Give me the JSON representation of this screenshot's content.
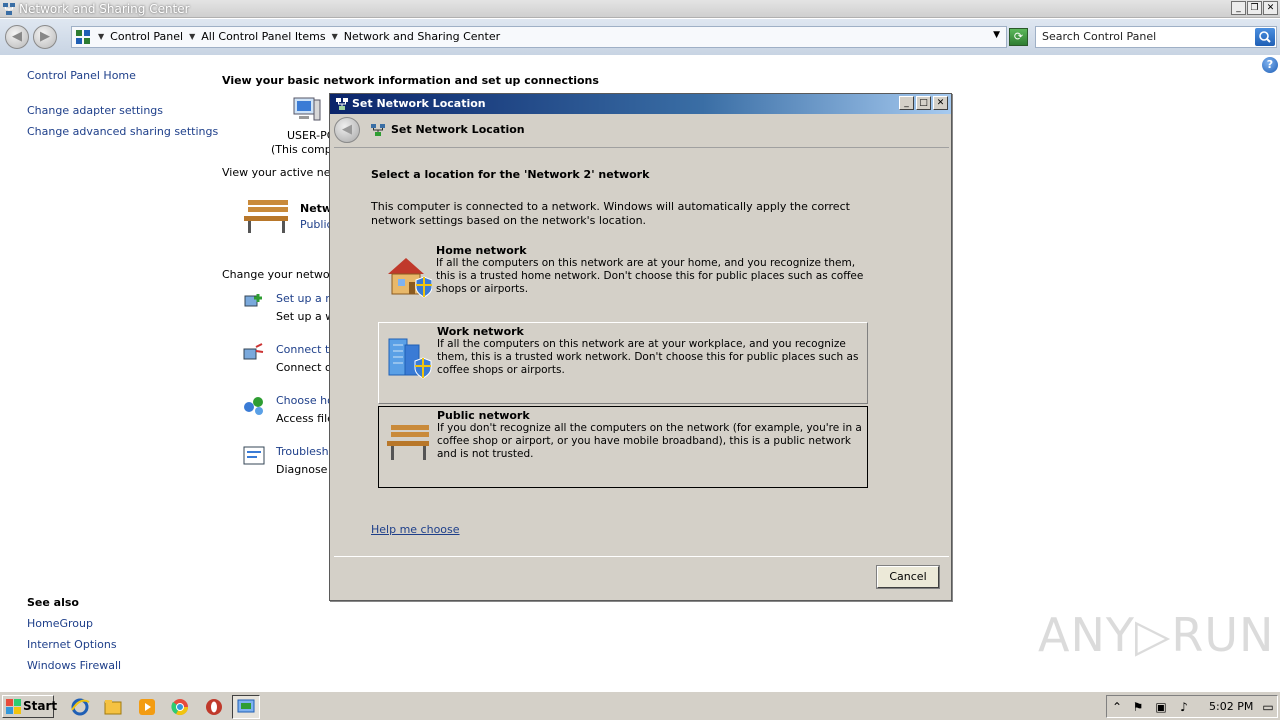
{
  "window": {
    "title": "Network and Sharing Center",
    "controls": {
      "minimize": "_",
      "maximize": "❐",
      "close": "✕"
    }
  },
  "address": {
    "crumbs": [
      "Control Panel",
      "All Control Panel Items",
      "Network and Sharing Center"
    ],
    "search_placeholder": "Search Control Panel"
  },
  "left_pane": {
    "home": "Control Panel Home",
    "links": [
      "Change adapter settings",
      "Change advanced sharing settings"
    ],
    "see_also_title": "See also",
    "see_also": [
      "HomeGroup",
      "Internet Options",
      "Windows Firewall"
    ]
  },
  "main": {
    "title": "View your basic network information and set up connections",
    "computer_name": "USER-PC",
    "computer_sub": "(This compu",
    "active_networks": "View your active netw",
    "network_name": "Netw",
    "network_type": "Public",
    "change_settings": "Change your networki",
    "tasks": [
      {
        "link": "Set up a ne",
        "desc": "Set up a wi"
      },
      {
        "link": "Connect to",
        "desc": "Connect or"
      },
      {
        "link": "Choose hor",
        "desc": "Access files"
      },
      {
        "link": "Troublesho",
        "desc": "Diagnose a"
      }
    ]
  },
  "dialog": {
    "title": "Set Network Location",
    "header_title": "Set Network Location",
    "heading": "Select a location for the 'Network  2' network",
    "intro": "This computer is connected to a network. Windows will automatically apply the correct network settings based on the network's location.",
    "options": [
      {
        "title": "Home network",
        "desc": "If all the computers on this network are at your home, and you recognize them, this is a trusted home network.  Don't choose this for public places such as coffee shops or airports."
      },
      {
        "title": "Work network",
        "desc": "If all the computers on this network are at your workplace, and you recognize them, this is a trusted work network.  Don't choose this for public places such as coffee shops or airports."
      },
      {
        "title": "Public network",
        "desc": "If you don't recognize all the computers on the network (for example, you're in a coffee shop or airport, or you have mobile broadband), this is a public network and is not trusted."
      }
    ],
    "help_link": "Help me choose",
    "cancel": "Cancel"
  },
  "watermark": "ANY▷RUN",
  "taskbar": {
    "start": "Start",
    "clock": "5:02 PM"
  },
  "colors": {
    "link": "#1e3f8a",
    "dialog_bg": "#d4d0c8",
    "dialog_title_start": "#0a246a",
    "dialog_title_end": "#a6caf0"
  }
}
